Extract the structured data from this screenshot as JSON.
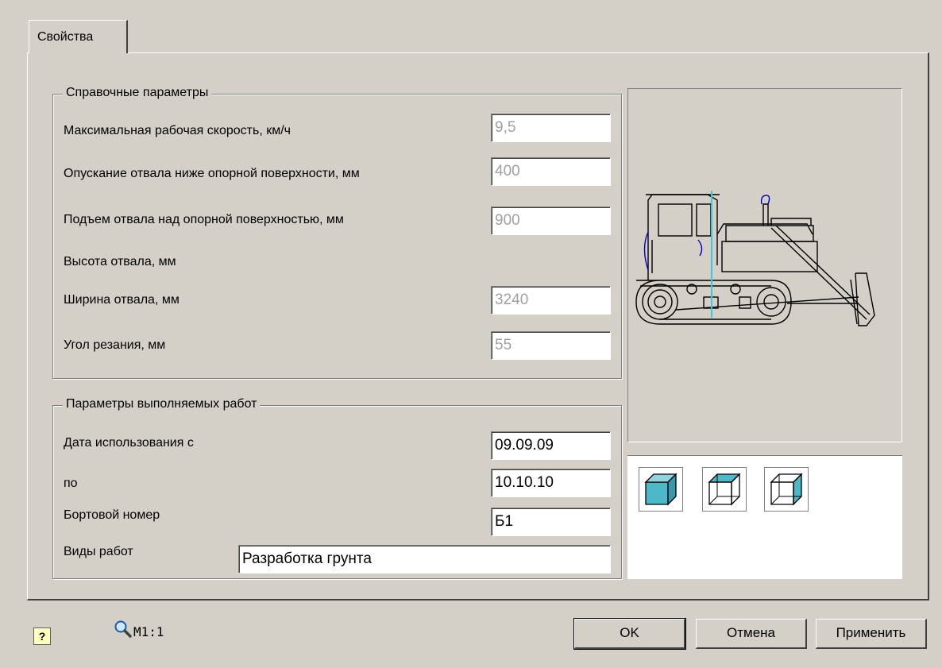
{
  "tabs": [
    {
      "label": "Свойства"
    }
  ],
  "ref_group": {
    "title": "Справочные параметры",
    "rows": [
      {
        "label": "Максимальная рабочая скорость, км/ч",
        "value": "9,5"
      },
      {
        "label": "Опускание отвала ниже опорной поверхности, мм",
        "value": "400"
      },
      {
        "label": "Подъем отвала над опорной поверхностью, мм",
        "value": "900"
      },
      {
        "label": "Высота отвала, мм"
      },
      {
        "label": "Ширина отвала, мм",
        "value": "3240"
      },
      {
        "label": "Угол резания, мм",
        "value": "55"
      }
    ]
  },
  "work_group": {
    "title": "Параметры выполняемых работ",
    "date_from_label": "Дата использования с",
    "date_from": "09.09.09",
    "date_to_label": "по",
    "date_to": "10.10.10",
    "board_label": "Бортовой номер",
    "board": "Б1",
    "works_label": "Виды работ",
    "works": "Разработка грунта"
  },
  "view_buttons": [
    {
      "icon": "shaded-cube-icon"
    },
    {
      "icon": "top-face-cube-icon"
    },
    {
      "icon": "wireframe-cube-icon"
    }
  ],
  "footer": {
    "help_glyph": "?",
    "scale_label": "M1:1",
    "ok_label": "OK",
    "cancel_label": "Отмена",
    "apply_label": "Применить"
  },
  "colors": {
    "accent": "#4fb8c8",
    "dialog_bg": "#d4d0c8"
  }
}
